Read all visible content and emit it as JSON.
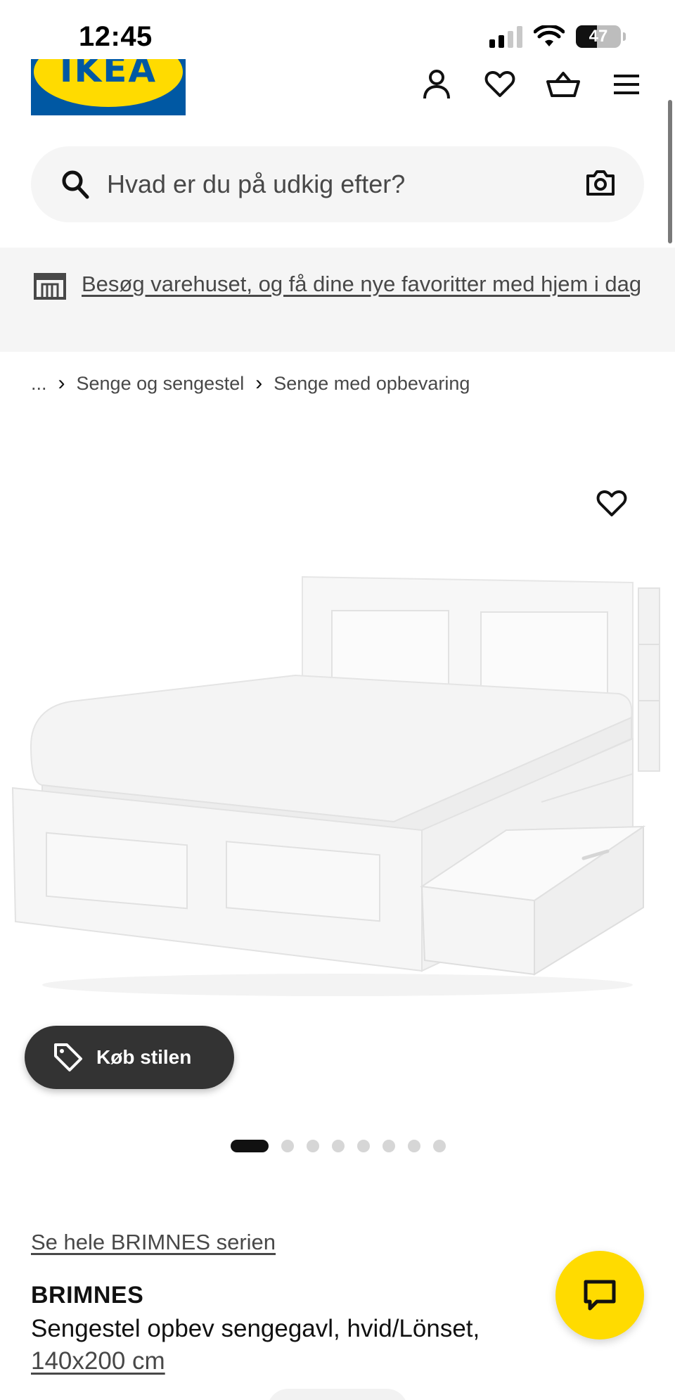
{
  "status_bar": {
    "time": "12:45",
    "battery": "47",
    "battery_level": 0.47
  },
  "header": {
    "logo_text": "IKEA",
    "icons": [
      "user-icon",
      "heart-icon",
      "basket-icon",
      "menu-icon"
    ]
  },
  "search": {
    "placeholder": "Hvad er du på udkig efter?",
    "value": ""
  },
  "banner": {
    "text": "Besøg varehuset, og få dine nye favoritter med hjem i dag"
  },
  "breadcrumb": {
    "ellipsis": "...",
    "items": [
      "Senge og sengestel",
      "Senge med opbevaring"
    ]
  },
  "product_gallery": {
    "style_button_label": "Køb stilen",
    "image_count": 8,
    "active_image": 1
  },
  "product": {
    "series_link": "Se hele BRIMNES serien",
    "name": "BRIMNES",
    "description": "Sengestel opbev sengegavl, hvid/Lönset,",
    "size": "140x200 cm"
  },
  "colors": {
    "ikea_blue": "#0058a3",
    "ikea_yellow": "#ffdb00",
    "dark_button": "#333333",
    "banner_bg": "#f5f5f5"
  }
}
